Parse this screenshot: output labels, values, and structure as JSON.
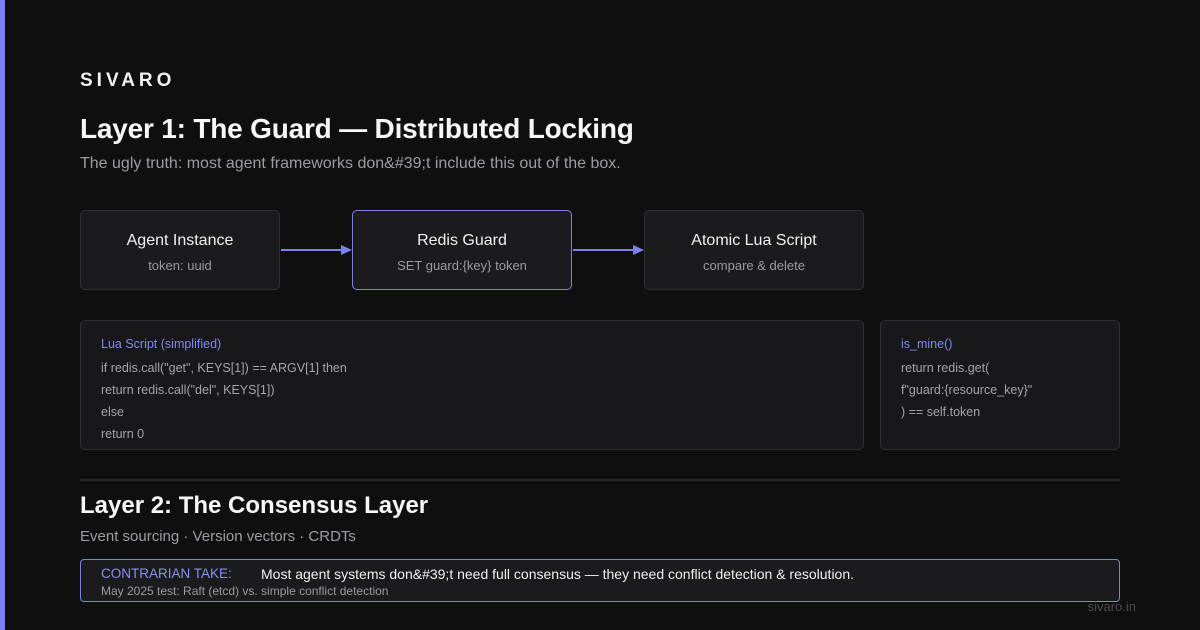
{
  "brand": "SIVARO",
  "layer1": {
    "title": "Layer 1: The Guard — Distributed Locking",
    "subtitle": "The ugly truth: most agent frameworks don&#39;t include this out of the box."
  },
  "flow": [
    {
      "title": "Agent Instance",
      "subtitle": "token: uuid"
    },
    {
      "title": "Redis Guard",
      "subtitle": "SET guard:{key} token"
    },
    {
      "title": "Atomic Lua Script",
      "subtitle": "compare & delete"
    }
  ],
  "lua_panel": {
    "heading": "Lua Script (simplified)",
    "lines": [
      "if redis.call(\"get\", KEYS[1]) == ARGV[1] then",
      "return redis.call(\"del\", KEYS[1])",
      "else",
      "return 0"
    ]
  },
  "mine_panel": {
    "heading": "is_mine()",
    "lines": [
      "return redis.get(",
      "f\"guard:{resource_key}\"",
      ") == self.token"
    ]
  },
  "layer2": {
    "title": "Layer 2: The Consensus Layer",
    "subtitle": "Event sourcing · Version vectors · CRDTs"
  },
  "callout": {
    "label": "CONTRARIAN TAKE:",
    "message": "Most agent systems don&#39;t need full consensus — they need conflict detection & resolution.",
    "note": "May 2025 test: Raft (etcd) vs. simple conflict detection"
  },
  "footer": "sivaro.in",
  "colors": {
    "accent": "#7b83eb",
    "background": "#0f0f10"
  }
}
